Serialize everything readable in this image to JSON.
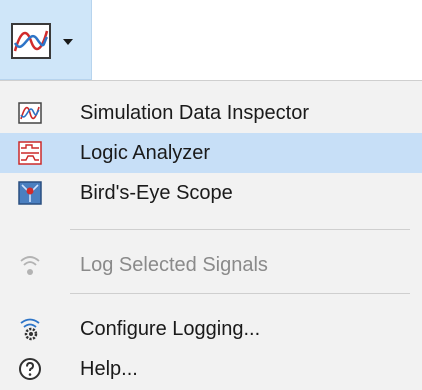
{
  "toolbar": {
    "button_icon": "sdi-dropdown-icon",
    "arrow_icon": "chevron-down-icon"
  },
  "menu": {
    "items": [
      {
        "label": "Simulation Data Inspector",
        "icon": "sdi-icon",
        "selected": false,
        "disabled": false
      },
      {
        "label": "Logic Analyzer",
        "icon": "logic-analyzer-icon",
        "selected": true,
        "disabled": false
      },
      {
        "label": "Bird's-Eye Scope",
        "icon": "birds-eye-scope-icon",
        "selected": false,
        "disabled": false
      },
      {
        "label": "Log Selected Signals",
        "icon": "log-signals-icon",
        "selected": false,
        "disabled": true
      },
      {
        "label": "Configure Logging...",
        "icon": "configure-logging-icon",
        "selected": false,
        "disabled": false
      },
      {
        "label": "Help...",
        "icon": "help-icon",
        "selected": false,
        "disabled": false
      }
    ]
  },
  "colors": {
    "selected_bg": "#c7dff7",
    "menu_bg": "#f2f2f2",
    "toolbar_active_bg": "#cfe6f9",
    "disabled_text": "#8a8a8a"
  }
}
